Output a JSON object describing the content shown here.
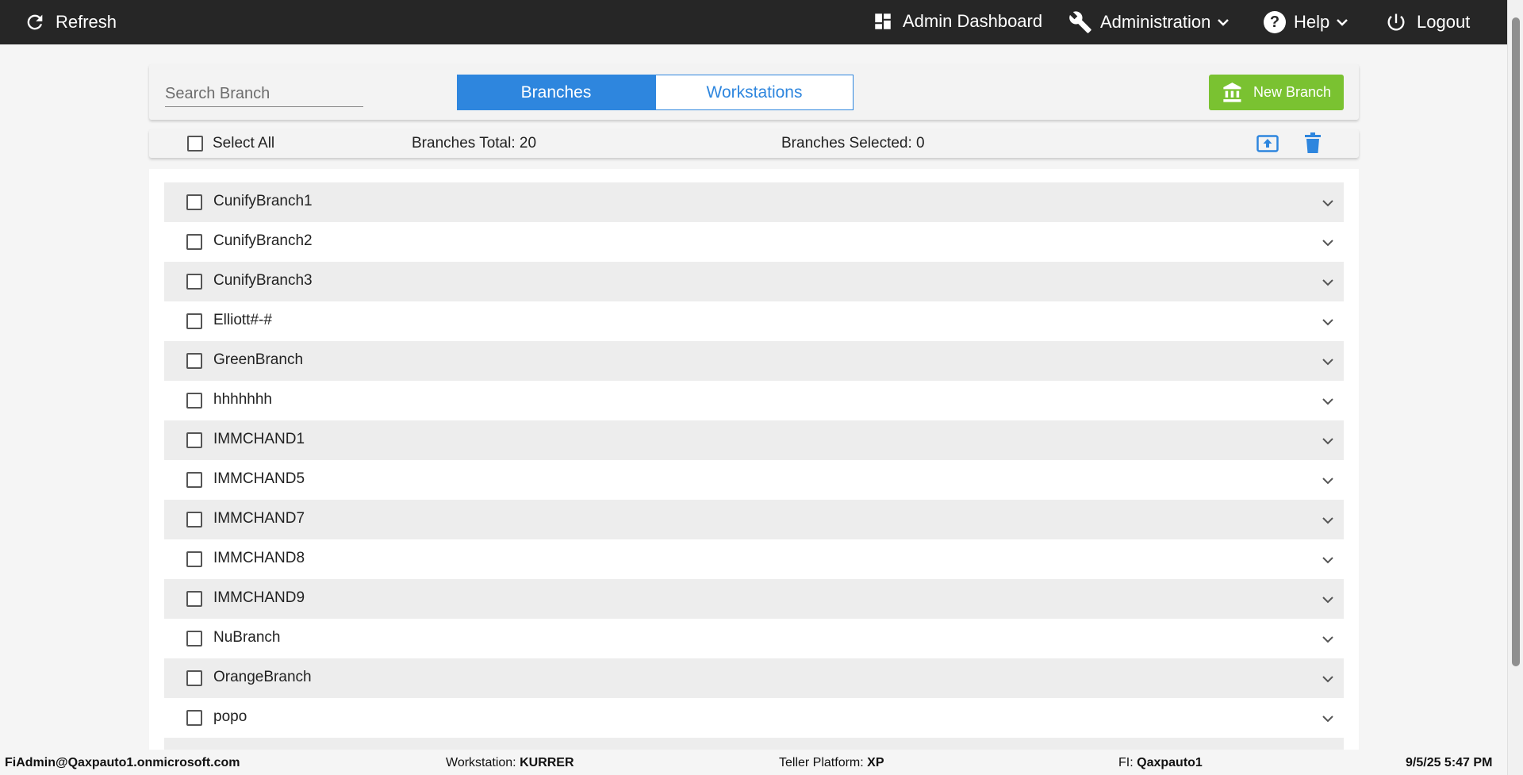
{
  "topbar": {
    "refresh_label": "Refresh",
    "admin_dashboard_label": "Admin Dashboard",
    "administration_label": "Administration",
    "help_label": "Help",
    "help_icon_glyph": "?",
    "logout_label": "Logout"
  },
  "header": {
    "search_placeholder": "Search Branch",
    "tabs": [
      {
        "label": "Branches",
        "active": true
      },
      {
        "label": "Workstations",
        "active": false
      }
    ],
    "new_branch_label": "New Branch"
  },
  "toolbar": {
    "select_all_label": "Select All",
    "branches_total": "Branches Total: 20",
    "branches_selected": "Branches Selected: 0"
  },
  "branches": [
    {
      "name": "CunifyBranch1"
    },
    {
      "name": "CunifyBranch2"
    },
    {
      "name": "CunifyBranch3"
    },
    {
      "name": "Elliott#-#"
    },
    {
      "name": "GreenBranch"
    },
    {
      "name": "hhhhhhh"
    },
    {
      "name": "IMMCHAND1"
    },
    {
      "name": "IMMCHAND5"
    },
    {
      "name": "IMMCHAND7"
    },
    {
      "name": "IMMCHAND8"
    },
    {
      "name": "IMMCHAND9"
    },
    {
      "name": "NuBranch"
    },
    {
      "name": "OrangeBranch"
    },
    {
      "name": "popo"
    }
  ],
  "footer": {
    "user": "FiAdmin@Qaxpauto1.onmicrosoft.com",
    "workstation_label": "Workstation:",
    "workstation_value": "KURRER",
    "platform_label": "Teller Platform:",
    "platform_value": "XP",
    "fi_label": "FI:",
    "fi_value": "Qaxpauto1",
    "datetime": "9/5/25 5:47 PM"
  },
  "colors": {
    "topbar_bg": "#262626",
    "accent_blue": "#2e86de",
    "new_branch_green": "#7ac231",
    "row_shade": "#ededed"
  }
}
